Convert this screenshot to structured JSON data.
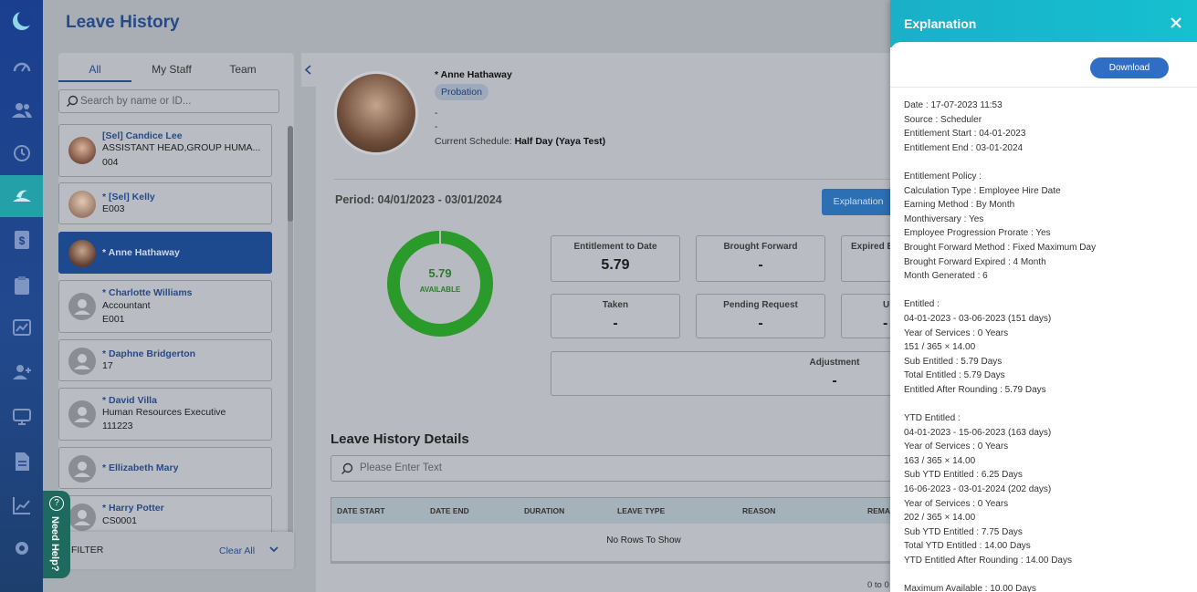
{
  "header": {
    "title": "Leave History"
  },
  "staff_panel": {
    "tabs": [
      "All",
      "My Staff",
      "Team"
    ],
    "search_placeholder": "Search by name or ID...",
    "staff": [
      {
        "name": "[Sel] Candice Lee",
        "line2": "ASSISTANT HEAD,GROUP HUMA...",
        "line3": "004"
      },
      {
        "name": "* [Sel] Kelly",
        "line2": "E003",
        "line3": ""
      },
      {
        "name": "* Anne Hathaway",
        "line2": "",
        "line3": ""
      },
      {
        "name": "* Charlotte Williams",
        "line2": "Accountant",
        "line3": "E001"
      },
      {
        "name": "* Daphne Bridgerton",
        "line2": "17",
        "line3": ""
      },
      {
        "name": "* David Villa",
        "line2": "Human Resources Executive",
        "line3": "111223"
      },
      {
        "name": "* Ellizabeth Mary",
        "line2": "",
        "line3": ""
      },
      {
        "name": "* Harry Potter",
        "line2": "CS0001",
        "line3": ""
      }
    ],
    "filter_label": "FILTER",
    "clear_all": "Clear All"
  },
  "need_help": "Need Help?",
  "profile": {
    "name": "* Anne Hathaway",
    "status_badge": "Probation",
    "dash1": "-",
    "dash2": "-",
    "schedule_label": "Current Schedule:",
    "schedule_value": "Half Day (Yaya Test)"
  },
  "period": "Period: 04/01/2023 - 03/01/2024",
  "explanation_button": "Explanation",
  "donut": {
    "value": "5.79",
    "label": "AVAILABLE",
    "fraction": 1.0,
    "color": "#2a9a2a"
  },
  "stats": {
    "entitlement_to_date": {
      "title": "Entitlement to Date",
      "value": "5.79"
    },
    "brought_forward": {
      "title": "Brought Forward",
      "value": "-"
    },
    "expired": {
      "title": "Expired B",
      "value": ""
    },
    "taken": {
      "title": "Taken",
      "value": "-"
    },
    "pending": {
      "title": "Pending Request",
      "value": "-"
    },
    "unused": {
      "title": "U",
      "value": "-"
    },
    "adjustment": {
      "title": "Adjustment",
      "value": "-"
    }
  },
  "details": {
    "title": "Leave History Details",
    "search_placeholder": "Please Enter Text",
    "columns": [
      "DATE START",
      "DATE END",
      "DURATION",
      "LEAVE TYPE",
      "REASON",
      "REMA"
    ],
    "no_rows": "No Rows To Show",
    "paging": "0 to 0"
  },
  "explanation_panel": {
    "title": "Explanation",
    "download": "Download",
    "lines": [
      "Date : 17-07-2023 11:53",
      "Source : Scheduler",
      "Entitlement Start : 04-01-2023",
      "Entitlement End : 03-01-2024",
      "",
      "Entitlement Policy :",
      "Calculation Type : Employee Hire Date",
      "Earning Method : By Month",
      "Monthiversary : Yes",
      "Employee Progression Prorate : Yes",
      "Brought Forward Method : Fixed Maximum Day",
      "Brought Forward Expired : 4 Month",
      "Month Generated : 6",
      "",
      "Entitled :",
      "04-01-2023 - 03-06-2023 (151 days)",
      "Year of Services : 0 Years",
      "151 / 365 × 14.00",
      "Sub Entitled : 5.79 Days",
      "Total Entitled : 5.79 Days",
      "Entitled After Rounding : 5.79 Days",
      "",
      "YTD Entitled :",
      "04-01-2023 - 15-06-2023 (163 days)",
      "Year of Services : 0 Years",
      "163 / 365 × 14.00",
      "Sub YTD Entitled : 6.25 Days",
      "16-06-2023 - 03-01-2024 (202 days)",
      "Year of Services : 0 Years",
      "202 / 365 × 14.00",
      "Sub YTD Entitled : 7.75 Days",
      "Total YTD Entitled : 14.00 Days",
      "YTD Entitled After Rounding : 14.00 Days",
      "",
      "Maximum Available : 10.00 Days"
    ]
  }
}
